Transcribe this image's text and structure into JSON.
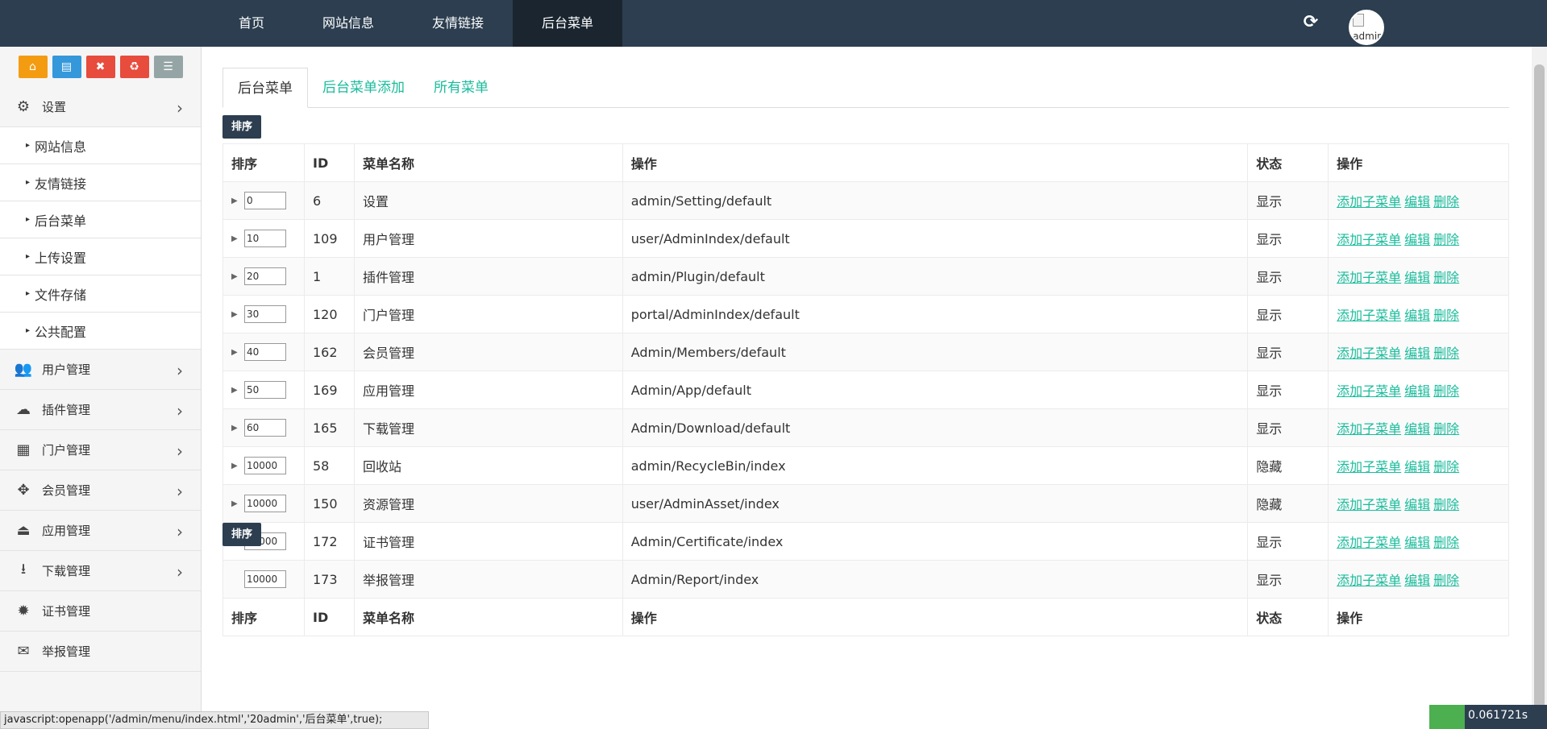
{
  "topnav": {
    "items": [
      {
        "label": "首页"
      },
      {
        "label": "网站信息"
      },
      {
        "label": "友情链接"
      },
      {
        "label": "后台菜单"
      }
    ],
    "avatar_alt": "admin"
  },
  "sidebar": {
    "settings": {
      "label": "设置"
    },
    "settings_subs": [
      {
        "label": "网站信息"
      },
      {
        "label": "友情链接"
      },
      {
        "label": "后台菜单"
      },
      {
        "label": "上传设置"
      },
      {
        "label": "文件存储"
      },
      {
        "label": "公共配置"
      }
    ],
    "items": [
      {
        "label": "用户管理",
        "icon": "users-icon"
      },
      {
        "label": "插件管理",
        "icon": "cloud-icon"
      },
      {
        "label": "门户管理",
        "icon": "grid-icon"
      },
      {
        "label": "会员管理",
        "icon": "arrows-icon"
      },
      {
        "label": "应用管理",
        "icon": "android-icon"
      },
      {
        "label": "下载管理",
        "icon": "download-icon"
      },
      {
        "label": "证书管理",
        "icon": "certificate-icon"
      },
      {
        "label": "举报管理",
        "icon": "envelope-open-icon"
      }
    ]
  },
  "tabs": [
    {
      "label": "后台菜单"
    },
    {
      "label": "后台菜单添加"
    },
    {
      "label": "所有菜单"
    }
  ],
  "sort_button": "排序",
  "table": {
    "headers": {
      "sort": "排序",
      "id": "ID",
      "name": "菜单名称",
      "op": "操作",
      "status": "状态",
      "actions": "操作"
    },
    "action_labels": {
      "add": "添加子菜单",
      "edit": "编辑",
      "delete": "删除"
    },
    "rows": [
      {
        "sort": "0",
        "id": "6",
        "name": "设置",
        "op": "admin/Setting/default",
        "status": "显示"
      },
      {
        "sort": "10",
        "id": "109",
        "name": "用户管理",
        "op": "user/AdminIndex/default",
        "status": "显示"
      },
      {
        "sort": "20",
        "id": "1",
        "name": "插件管理",
        "op": "admin/Plugin/default",
        "status": "显示"
      },
      {
        "sort": "30",
        "id": "120",
        "name": "门户管理",
        "op": "portal/AdminIndex/default",
        "status": "显示"
      },
      {
        "sort": "40",
        "id": "162",
        "name": "会员管理",
        "op": "Admin/Members/default",
        "status": "显示"
      },
      {
        "sort": "50",
        "id": "169",
        "name": "应用管理",
        "op": "Admin/App/default",
        "status": "显示"
      },
      {
        "sort": "60",
        "id": "165",
        "name": "下载管理",
        "op": "Admin/Download/default",
        "status": "显示"
      },
      {
        "sort": "10000",
        "id": "58",
        "name": "回收站",
        "op": "admin/RecycleBin/index",
        "status": "隐藏"
      },
      {
        "sort": "10000",
        "id": "150",
        "name": "资源管理",
        "op": "user/AdminAsset/index",
        "status": "隐藏"
      },
      {
        "sort": "10000",
        "id": "172",
        "name": "证书管理",
        "op": "Admin/Certificate/index",
        "status": "显示"
      },
      {
        "sort": "10000",
        "id": "173",
        "name": "举报管理",
        "op": "Admin/Report/index",
        "status": "显示"
      }
    ]
  },
  "statusbar": "javascript:openapp('/admin/menu/index.html','20admin','后台菜单',true);",
  "timer": "0.061721s",
  "colors": {
    "topbar": "#2c3e50",
    "link": "#1abc9c"
  }
}
